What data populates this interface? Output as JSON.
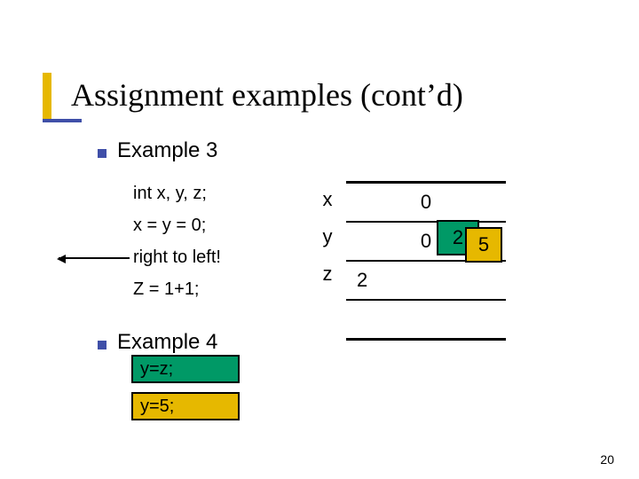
{
  "title": "Assignment examples (cont’d)",
  "bullets": {
    "ex3": "Example 3",
    "ex4": "Example 4"
  },
  "code": {
    "line1": "int x, y, z;",
    "line2": "x = y = 0;",
    "line3": "right to left!",
    "line4": "Z = 1+1;"
  },
  "memory": {
    "vars": [
      "x",
      "y",
      "z"
    ],
    "rows": {
      "x": "0",
      "y_base": "0",
      "y_over_green": "2",
      "y_over_yellow": "5",
      "z": "2"
    }
  },
  "example4": {
    "line1": "y=z;",
    "line2": "y=5;"
  },
  "page_number": "20"
}
